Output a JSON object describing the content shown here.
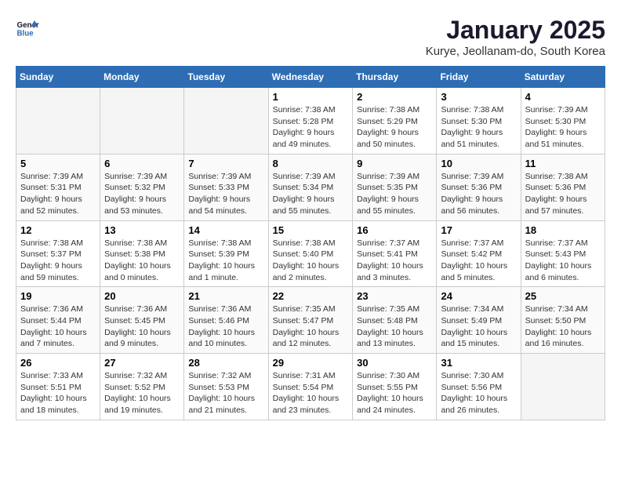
{
  "logo": {
    "line1": "General",
    "line2": "Blue"
  },
  "title": "January 2025",
  "subtitle": "Kurye, Jeollanam-do, South Korea",
  "headers": [
    "Sunday",
    "Monday",
    "Tuesday",
    "Wednesday",
    "Thursday",
    "Friday",
    "Saturday"
  ],
  "weeks": [
    [
      {
        "day": "",
        "empty": true
      },
      {
        "day": "",
        "empty": true
      },
      {
        "day": "",
        "empty": true
      },
      {
        "day": "1",
        "sunrise": "7:38 AM",
        "sunset": "5:28 PM",
        "daylight": "9 hours and 49 minutes."
      },
      {
        "day": "2",
        "sunrise": "7:38 AM",
        "sunset": "5:29 PM",
        "daylight": "9 hours and 50 minutes."
      },
      {
        "day": "3",
        "sunrise": "7:38 AM",
        "sunset": "5:30 PM",
        "daylight": "9 hours and 51 minutes."
      },
      {
        "day": "4",
        "sunrise": "7:39 AM",
        "sunset": "5:30 PM",
        "daylight": "9 hours and 51 minutes."
      }
    ],
    [
      {
        "day": "5",
        "sunrise": "7:39 AM",
        "sunset": "5:31 PM",
        "daylight": "9 hours and 52 minutes."
      },
      {
        "day": "6",
        "sunrise": "7:39 AM",
        "sunset": "5:32 PM",
        "daylight": "9 hours and 53 minutes."
      },
      {
        "day": "7",
        "sunrise": "7:39 AM",
        "sunset": "5:33 PM",
        "daylight": "9 hours and 54 minutes."
      },
      {
        "day": "8",
        "sunrise": "7:39 AM",
        "sunset": "5:34 PM",
        "daylight": "9 hours and 55 minutes."
      },
      {
        "day": "9",
        "sunrise": "7:39 AM",
        "sunset": "5:35 PM",
        "daylight": "9 hours and 55 minutes."
      },
      {
        "day": "10",
        "sunrise": "7:39 AM",
        "sunset": "5:36 PM",
        "daylight": "9 hours and 56 minutes."
      },
      {
        "day": "11",
        "sunrise": "7:38 AM",
        "sunset": "5:36 PM",
        "daylight": "9 hours and 57 minutes."
      }
    ],
    [
      {
        "day": "12",
        "sunrise": "7:38 AM",
        "sunset": "5:37 PM",
        "daylight": "9 hours and 59 minutes."
      },
      {
        "day": "13",
        "sunrise": "7:38 AM",
        "sunset": "5:38 PM",
        "daylight": "10 hours and 0 minutes."
      },
      {
        "day": "14",
        "sunrise": "7:38 AM",
        "sunset": "5:39 PM",
        "daylight": "10 hours and 1 minute."
      },
      {
        "day": "15",
        "sunrise": "7:38 AM",
        "sunset": "5:40 PM",
        "daylight": "10 hours and 2 minutes."
      },
      {
        "day": "16",
        "sunrise": "7:37 AM",
        "sunset": "5:41 PM",
        "daylight": "10 hours and 3 minutes."
      },
      {
        "day": "17",
        "sunrise": "7:37 AM",
        "sunset": "5:42 PM",
        "daylight": "10 hours and 5 minutes."
      },
      {
        "day": "18",
        "sunrise": "7:37 AM",
        "sunset": "5:43 PM",
        "daylight": "10 hours and 6 minutes."
      }
    ],
    [
      {
        "day": "19",
        "sunrise": "7:36 AM",
        "sunset": "5:44 PM",
        "daylight": "10 hours and 7 minutes."
      },
      {
        "day": "20",
        "sunrise": "7:36 AM",
        "sunset": "5:45 PM",
        "daylight": "10 hours and 9 minutes."
      },
      {
        "day": "21",
        "sunrise": "7:36 AM",
        "sunset": "5:46 PM",
        "daylight": "10 hours and 10 minutes."
      },
      {
        "day": "22",
        "sunrise": "7:35 AM",
        "sunset": "5:47 PM",
        "daylight": "10 hours and 12 minutes."
      },
      {
        "day": "23",
        "sunrise": "7:35 AM",
        "sunset": "5:48 PM",
        "daylight": "10 hours and 13 minutes."
      },
      {
        "day": "24",
        "sunrise": "7:34 AM",
        "sunset": "5:49 PM",
        "daylight": "10 hours and 15 minutes."
      },
      {
        "day": "25",
        "sunrise": "7:34 AM",
        "sunset": "5:50 PM",
        "daylight": "10 hours and 16 minutes."
      }
    ],
    [
      {
        "day": "26",
        "sunrise": "7:33 AM",
        "sunset": "5:51 PM",
        "daylight": "10 hours and 18 minutes."
      },
      {
        "day": "27",
        "sunrise": "7:32 AM",
        "sunset": "5:52 PM",
        "daylight": "10 hours and 19 minutes."
      },
      {
        "day": "28",
        "sunrise": "7:32 AM",
        "sunset": "5:53 PM",
        "daylight": "10 hours and 21 minutes."
      },
      {
        "day": "29",
        "sunrise": "7:31 AM",
        "sunset": "5:54 PM",
        "daylight": "10 hours and 23 minutes."
      },
      {
        "day": "30",
        "sunrise": "7:30 AM",
        "sunset": "5:55 PM",
        "daylight": "10 hours and 24 minutes."
      },
      {
        "day": "31",
        "sunrise": "7:30 AM",
        "sunset": "5:56 PM",
        "daylight": "10 hours and 26 minutes."
      },
      {
        "day": "",
        "empty": true
      }
    ]
  ]
}
